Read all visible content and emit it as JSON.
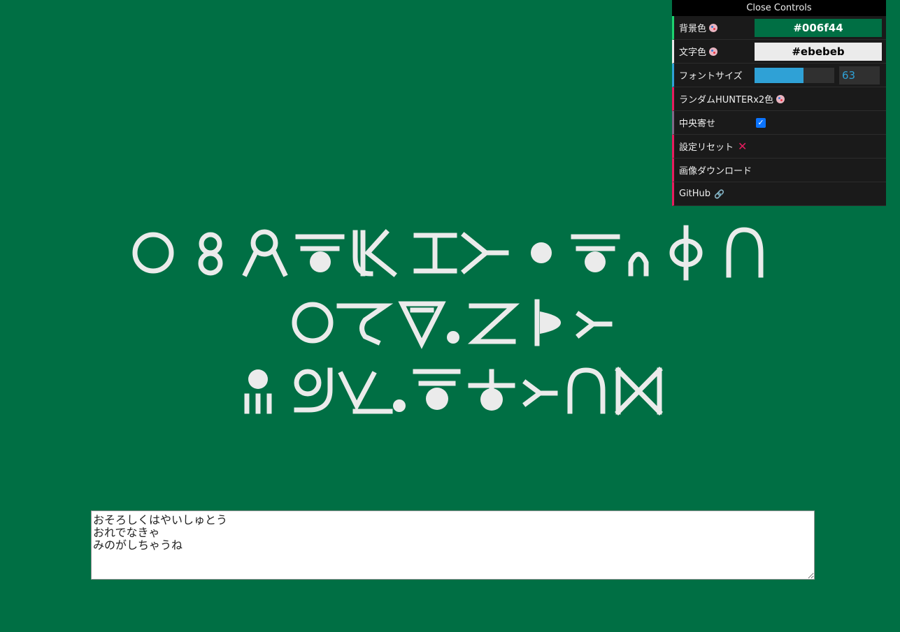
{
  "page": {
    "background": "#006f44",
    "text_color": "#ebebeb"
  },
  "controls": {
    "close_label": "Close Controls",
    "bg_label": "背景色",
    "bg_value": "#006f44",
    "fg_label": "文字色",
    "fg_value": "#ebebeb",
    "font_size_label": "フォントサイズ",
    "font_size_value": "63",
    "font_size_fraction": 0.61,
    "random_label": "ランダムHUNTERx2色",
    "center_label": "中央寄せ",
    "center_checked": true,
    "reset_label": "設定リセット",
    "download_label": "画像ダウンロード",
    "github_label": "GitHub",
    "icons": {
      "palette": "palette-icon",
      "reset": "cross-icon",
      "link": "link-icon",
      "check": "checkmark-icon"
    }
  },
  "text_input": {
    "value": "おそろしくはやいしゅとう\nおれでなきゃ\nみのがしちゃうね"
  }
}
